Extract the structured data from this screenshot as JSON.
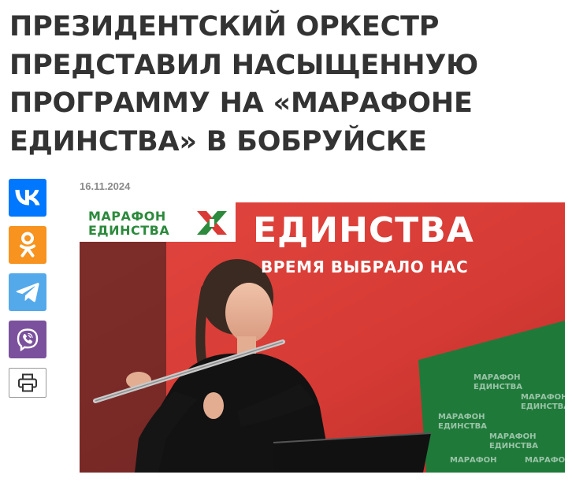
{
  "article": {
    "headline_lines": [
      "ПРЕЗИДЕНТСКИЙ ОРКЕСТР",
      "ПРЕДСТАВИЛ НАСЫЩЕННУЮ",
      "ПРОГРАММУ НА «МАРАФОНЕ",
      "ЕДИНСТВА» В БОБРУЙСКЕ"
    ],
    "date": "16.11.2024"
  },
  "share": [
    {
      "name": "vk",
      "icon": "vk-icon",
      "color": "#0077ff"
    },
    {
      "name": "odnoklassniki",
      "icon": "ok-icon",
      "color": "#f7931e"
    },
    {
      "name": "telegram",
      "icon": "telegram-icon",
      "color": "#54a9eb"
    },
    {
      "name": "viber",
      "icon": "viber-icon",
      "color": "#7b519d"
    },
    {
      "name": "print",
      "icon": "print-icon",
      "color": "#ffffff"
    }
  ],
  "photo": {
    "logo_line1": "МАРАФОН",
    "logo_line2": "ЕДИНСТВА",
    "banner_title": "ЕДИНСТВА",
    "banner_subtitle": "ВРЕМЯ ВЫБРАЛО НАС",
    "colors": {
      "banner_red": "#d93a35",
      "brand_green": "#2c8a3c"
    }
  }
}
